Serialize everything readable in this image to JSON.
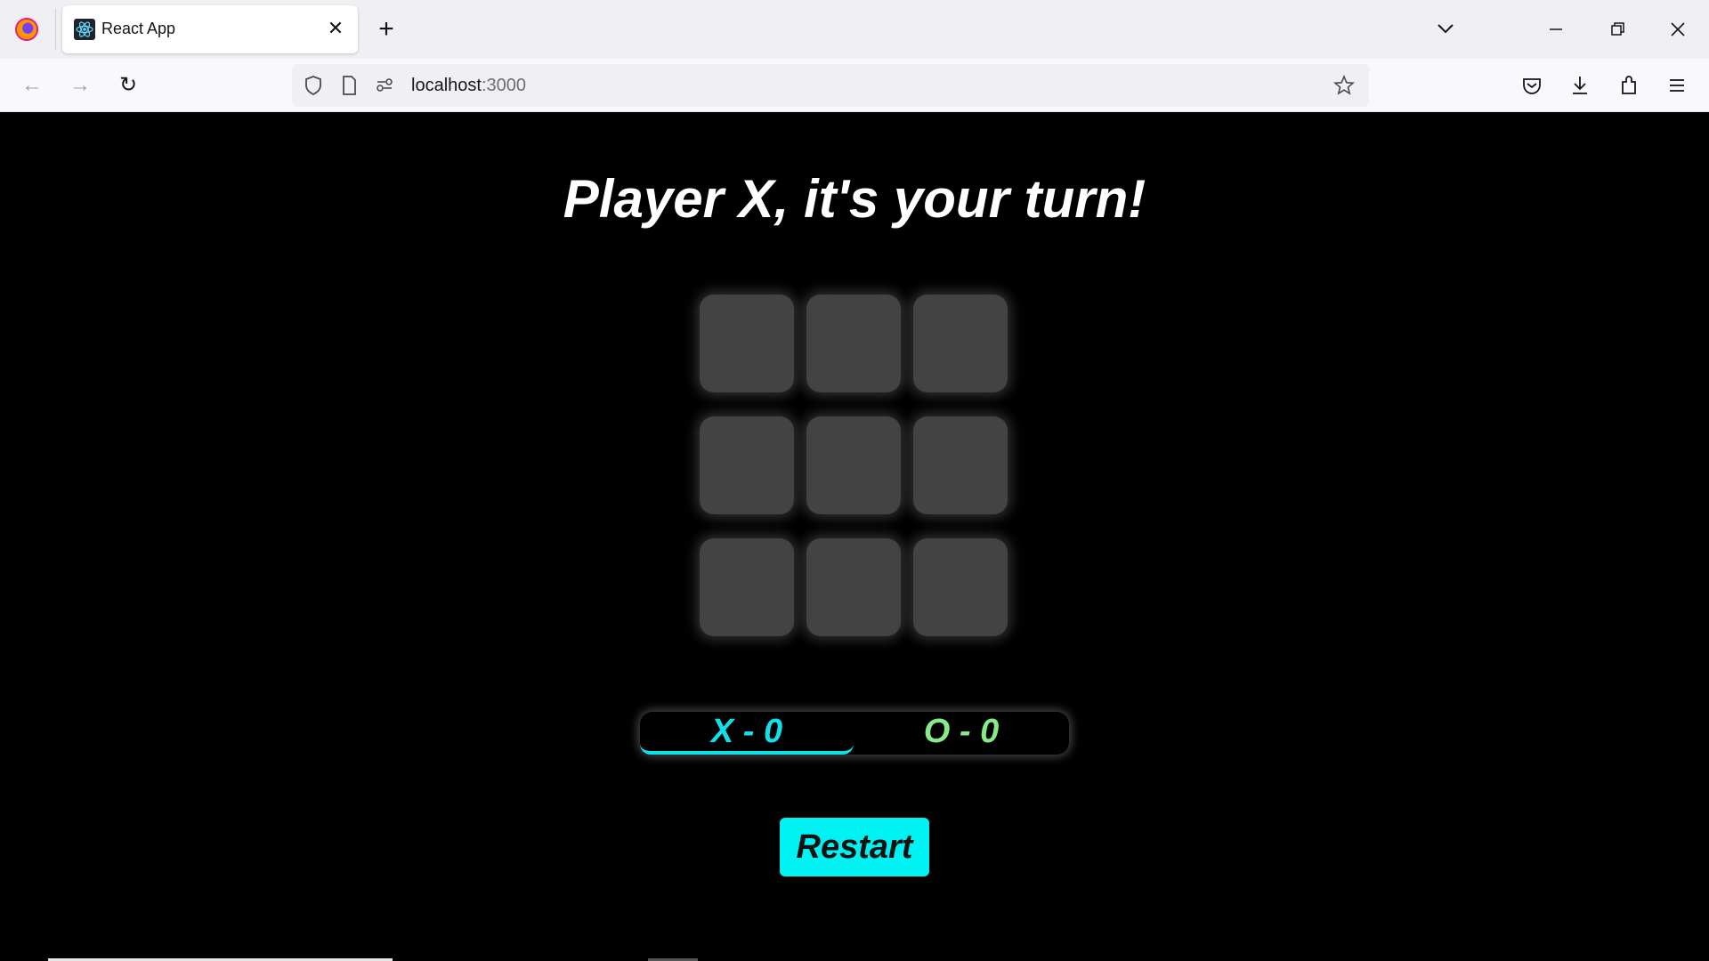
{
  "browser": {
    "tab_title": "React App",
    "url_host": "localhost",
    "url_port": ":3000",
    "icons": {
      "back": "←",
      "forward": "→",
      "reload": "↻",
      "close": "✕",
      "new_tab": "+",
      "list_tabs": "⌵",
      "minimize": "—",
      "restore": "❐",
      "close_window": "✕",
      "shield": "⛉",
      "page": "🗋",
      "permissions": "⚙",
      "star": "☆",
      "pocket": "⛊",
      "download": "⤓",
      "extensions": "⧉",
      "menu": "≡"
    }
  },
  "game": {
    "status": "Player X, it's your turn!",
    "cells": [
      "",
      "",
      "",
      "",
      "",
      "",
      "",
      "",
      ""
    ],
    "score_x": "X - 0",
    "score_o": "O - 0",
    "restart_label": "Restart"
  },
  "colors": {
    "x_accent": "#12e0e8",
    "o_accent": "#86e98a",
    "cell_bg": "#444344",
    "restart_bg": "#00f2f2"
  }
}
